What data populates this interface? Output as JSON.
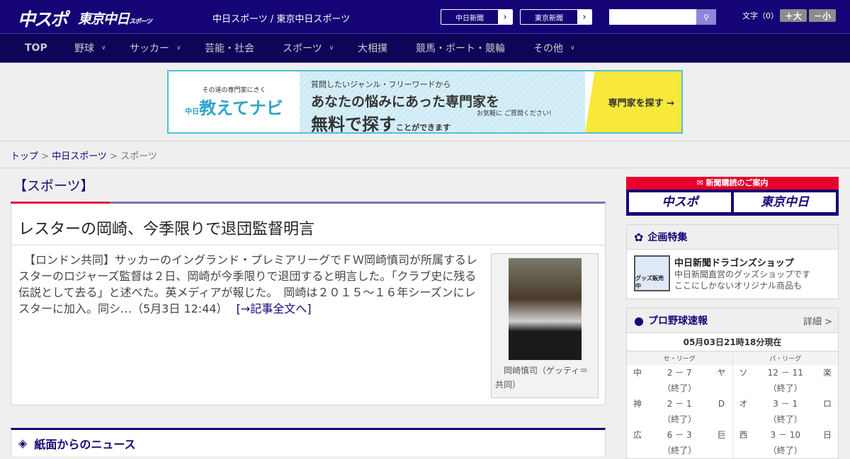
{
  "header": {
    "logo_chuspo": "中スポ",
    "logo_tokyo": "東京中日",
    "logo_tokyo_small": "スポーツ",
    "tagline": "中日スポーツ / 東京中日スポーツ",
    "link1": "中日新聞",
    "link2": "東京新聞",
    "search_placeholder": "",
    "font_label": "文字（0）",
    "font_plus": "＋大",
    "font_minus": "－小"
  },
  "nav": [
    "TOP",
    "野球",
    "サッカー",
    "芸能・社会",
    "スポーツ",
    "大相撲",
    "競馬・ボート・競輪",
    "その他"
  ],
  "ad": {
    "brand_sub": "その道の専門家にきく",
    "brand": "教えてナビ",
    "brand_prefix": "中日",
    "question": "質問したいジャンル・フリーワードから",
    "headline": "あなたの悩みにあった専門家を",
    "headline2": "無料で探す",
    "headline2_small": "ことができます",
    "note": "お気軽に ご質問ください!",
    "cta": "専門家を探す →"
  },
  "breadcrumb": {
    "top": "トップ",
    "parent": "中日スポーツ",
    "current": "スポーツ"
  },
  "category": "【スポーツ】",
  "article": {
    "title": "レスターの岡崎、今季限りで退団監督明言",
    "body": "　【ロンドン共同】サッカーのイングランド・プレミアリーグでＦＷ岡崎慎司が所属するレスターのロジャーズ監督は２日、岡崎が今季限りで退団すると明言した。「クラブ史に残る伝説として去る」と述べた。英メディアが報じた。　岡崎は２０１５～１６年シーズンにレスターに加入。同シ…（5月3日 12:44）",
    "link": "[→記事全文へ]",
    "caption": "岡崎慎司（ゲッティ＝共同）"
  },
  "section2": {
    "title": "紙面からのニュース"
  },
  "sidebar": {
    "subscription": {
      "title": "新聞購読のご案内",
      "btn1": "中スポ",
      "btn2": "東京中日"
    },
    "feature": {
      "title": "企画特集",
      "item_title": "中日新聞ドラゴンズショップ",
      "item_desc1": "中日新聞直営のグッズショップです",
      "item_desc2": "ここにしかないオリジナル商品も",
      "icon_label": "グッズ販売中"
    },
    "baseball": {
      "title": "プロ野球速報",
      "more": "詳細 >",
      "asof": "05月03日21時18分現在",
      "leagues": [
        {
          "name": "セ・リーグ",
          "games": [
            {
              "home": "中",
              "score": "2 － 7",
              "away": "ヤ",
              "status": "（終了）"
            },
            {
              "home": "神",
              "score": "2 － 1",
              "away": "D",
              "status": "（終了）"
            },
            {
              "home": "広",
              "score": "6 － 3",
              "away": "巨",
              "status": "（終了）"
            }
          ]
        },
        {
          "name": "パ・リーグ",
          "games": [
            {
              "home": "ソ",
              "score": "12 － 11",
              "away": "楽",
              "status": "（終了）"
            },
            {
              "home": "オ",
              "score": "3 － 1",
              "away": "ロ",
              "status": "（終了）"
            },
            {
              "home": "西",
              "score": "3 － 10",
              "away": "日",
              "status": "（終了）"
            }
          ]
        }
      ]
    }
  }
}
